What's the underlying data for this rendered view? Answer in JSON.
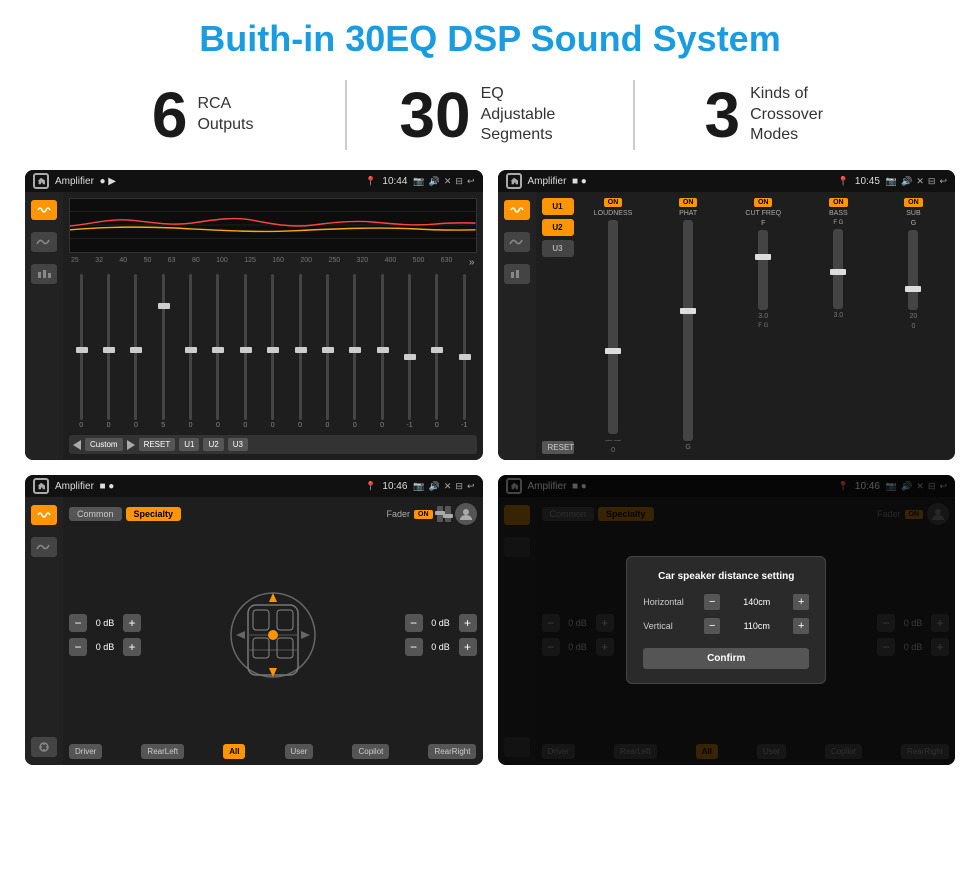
{
  "header": {
    "title": "Buith-in 30EQ DSP Sound System"
  },
  "stats": [
    {
      "number": "6",
      "label": "RCA\nOutputs"
    },
    {
      "number": "30",
      "label": "EQ Adjustable\nSegments"
    },
    {
      "number": "3",
      "label": "Kinds of\nCrossover Modes"
    }
  ],
  "screens": [
    {
      "id": "eq-screen",
      "status_bar": {
        "app": "Amplifier",
        "time": "10:44"
      },
      "type": "equalizer"
    },
    {
      "id": "amp2-screen",
      "status_bar": {
        "app": "Amplifier",
        "time": "10:45"
      },
      "type": "amplifier2",
      "presets": [
        "U1",
        "U2",
        "U3"
      ],
      "channels": [
        {
          "label": "LOUDNESS",
          "on": true
        },
        {
          "label": "PHAT",
          "on": true
        },
        {
          "label": "CUT FREQ",
          "on": true
        },
        {
          "label": "BASS",
          "on": true
        },
        {
          "label": "SUB",
          "on": true
        }
      ],
      "reset_label": "RESET"
    },
    {
      "id": "fader-screen",
      "status_bar": {
        "app": "Amplifier",
        "time": "10:46"
      },
      "type": "fader",
      "tabs": [
        "Common",
        "Specialty"
      ],
      "fader_label": "Fader",
      "on_label": "ON",
      "db_values": [
        "0 dB",
        "0 dB",
        "0 dB",
        "0 dB"
      ],
      "bottom_buttons": [
        "Driver",
        "All",
        "User",
        "RearRight",
        "Copilot",
        "RearLeft"
      ]
    },
    {
      "id": "modal-screen",
      "status_bar": {
        "app": "Amplifier",
        "time": "10:46"
      },
      "type": "modal",
      "modal": {
        "title": "Car speaker distance setting",
        "horizontal_label": "Horizontal",
        "horizontal_value": "140cm",
        "vertical_label": "Vertical",
        "vertical_value": "110cm",
        "confirm_label": "Confirm"
      }
    }
  ],
  "eq": {
    "frequencies": [
      "25",
      "32",
      "40",
      "50",
      "63",
      "80",
      "100",
      "125",
      "160",
      "200",
      "250",
      "320",
      "400",
      "500",
      "630"
    ],
    "values": [
      "0",
      "0",
      "0",
      "5",
      "0",
      "0",
      "0",
      "0",
      "0",
      "0",
      "0",
      "0",
      "-1",
      "0",
      "-1"
    ],
    "modes": [
      "Custom",
      "RESET",
      "U1",
      "U2",
      "U3"
    ]
  }
}
